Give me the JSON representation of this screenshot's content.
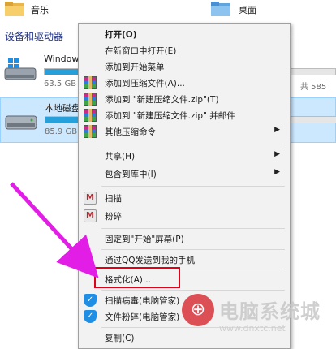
{
  "explorer": {
    "folders": [
      {
        "name": "音乐"
      },
      {
        "name": "桌面"
      }
    ],
    "section_title": "设备和驱动器",
    "drives": [
      {
        "name": "Windows",
        "size_text": "63.5 GB",
        "right_text": "共 585",
        "fill": 0.55,
        "selected": false
      },
      {
        "name": "本地磁盘",
        "size_text": "85.9 GB",
        "right_text": "",
        "fill": 0.25,
        "selected": true
      }
    ]
  },
  "context_menu": {
    "items": [
      {
        "label": "打开(O)",
        "bold": true,
        "icon": "",
        "submenu": false
      },
      {
        "label": "在新窗口中打开(E)",
        "bold": false,
        "icon": "",
        "submenu": false
      },
      {
        "label": "添加到开始菜单",
        "bold": false,
        "icon": "",
        "submenu": false
      },
      {
        "label": "添加到压缩文件(A)...",
        "bold": false,
        "icon": "winrar-icon",
        "submenu": false
      },
      {
        "label": "添加到 \"新建压缩文件.zip\"(T)",
        "bold": false,
        "icon": "winrar-icon",
        "submenu": false
      },
      {
        "label": "添加到 \"新建压缩文件.zip\" 并邮件",
        "bold": false,
        "icon": "winrar-icon",
        "submenu": false
      },
      {
        "label": "其他压缩命令",
        "bold": false,
        "icon": "winrar-icon",
        "submenu": true
      },
      {
        "label": "共享(H)",
        "bold": false,
        "icon": "",
        "submenu": true
      },
      {
        "label": "包含到库中(I)",
        "bold": false,
        "icon": "",
        "submenu": true
      },
      {
        "label": "扫描",
        "bold": false,
        "icon": "mcafee-shield-icon",
        "submenu": false
      },
      {
        "label": "粉碎",
        "bold": false,
        "icon": "mcafee-shield-icon",
        "submenu": false
      },
      {
        "label": "固定到\"开始\"屏幕(P)",
        "bold": false,
        "icon": "",
        "submenu": false
      },
      {
        "label": "通过QQ发送到我的手机",
        "bold": false,
        "icon": "",
        "submenu": false
      },
      {
        "label": "格式化(A)...",
        "bold": false,
        "icon": "",
        "submenu": false
      },
      {
        "label": "扫描病毒(电脑管家)",
        "bold": false,
        "icon": "qq-pc-manager-icon",
        "submenu": false
      },
      {
        "label": "文件粉碎(电脑管家)",
        "bold": false,
        "icon": "qq-pc-manager-icon",
        "submenu": false
      },
      {
        "label": "复制(C)",
        "bold": false,
        "icon": "",
        "submenu": false
      }
    ],
    "highlighted_item": "格式化(A)..."
  },
  "annotation": {
    "arrow_color": "#e21ee6",
    "highlight_color": "#e0001a"
  },
  "watermark": {
    "text": "电脑系统城",
    "url": "www.dnxtc.net"
  }
}
